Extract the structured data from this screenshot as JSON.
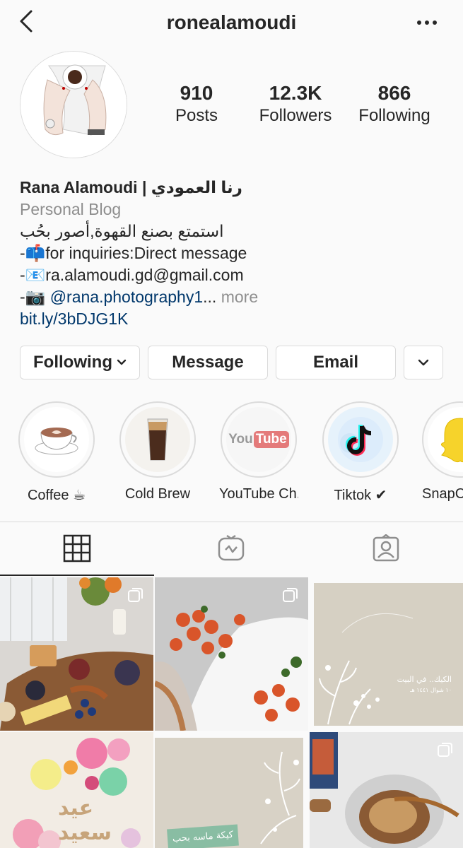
{
  "header": {
    "username": "ronealamoudi"
  },
  "stats": [
    {
      "value": "910",
      "label": "Posts"
    },
    {
      "value": "12.3K",
      "label": "Followers"
    },
    {
      "value": "866",
      "label": "Following"
    }
  ],
  "bio": {
    "name": "Rana Alamoudi | رنا العمودي",
    "category": "Personal Blog",
    "arabic_line": "استمتع بصنع القهوة,أصور بحُب",
    "line1": "-📫for inquiries:Direct message",
    "line2": "-📧ra.alamoudi.gd@gmail.com",
    "line3_prefix": "-📷 ",
    "line3_mention": "@rana.photography1",
    "line3_ellipsis": "...",
    "line3_more": " more",
    "link": "bit.ly/3bDJG1K"
  },
  "buttons": {
    "following": "Following",
    "message": "Message",
    "email": "Email"
  },
  "highlights": [
    {
      "label": "Coffee ☕"
    },
    {
      "label": "Cold Brew"
    },
    {
      "label": "YouTube Ch..."
    },
    {
      "label": "Tiktok ✔"
    },
    {
      "label": "SnapCh"
    }
  ],
  "highlight_art": {
    "youtube_text": "You",
    "youtube_tube": "Tube"
  },
  "posts": {
    "beige_arabic_title": "الكيك.. في البيت",
    "beige_arabic_sub": "١٠ شوال ١٤٤١ هـ",
    "eid_text": "عيد سعيد",
    "card_arabic": "كيكة ماسه بحب"
  },
  "icons": [
    "back-icon",
    "more-icon",
    "grid-icon",
    "igtv-icon",
    "tagged-icon",
    "chevron-down-icon",
    "multi-post-icon"
  ]
}
